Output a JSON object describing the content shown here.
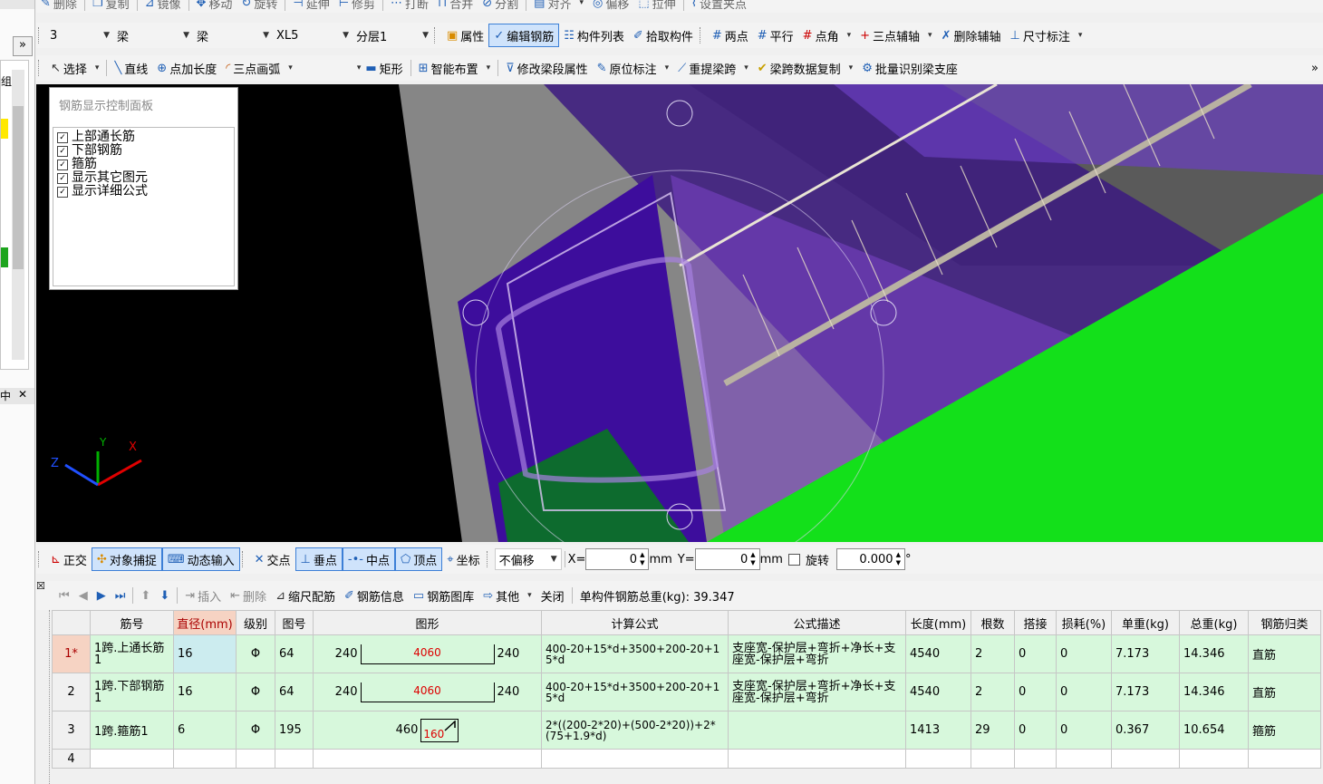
{
  "toolbar_top": {
    "items": [
      "删除",
      "复制",
      "镜像",
      "移动",
      "旋转",
      "延伸",
      "修剪",
      "打断",
      "合并",
      "分割",
      "对齐",
      "偏移",
      "拉伸",
      "设置夹点"
    ]
  },
  "left_pane": {
    "collapse": "»",
    "label": "组",
    "pin_label": "中",
    "close": "✕"
  },
  "toolbar2": {
    "combo_floor": "3",
    "combo_type1": "梁",
    "combo_type2": "梁",
    "combo_name": "XL5",
    "combo_layer": "分层1",
    "items": [
      "属性",
      "编辑钢筋",
      "构件列表",
      "拾取构件",
      "两点",
      "平行",
      "点角",
      "三点辅轴",
      "删除辅轴",
      "尺寸标注"
    ]
  },
  "toolbar3": {
    "items": [
      "选择",
      "直线",
      "点加长度",
      "三点画弧",
      "矩形",
      "智能布置",
      "修改梁段属性",
      "原位标注",
      "重提梁跨",
      "梁跨数据复制",
      "批量识别梁支座"
    ],
    "more": "»"
  },
  "rebar_panel": {
    "title": "钢筋显示控制面板",
    "options": [
      "上部通长筋",
      "下部钢筋",
      "箍筋",
      "显示其它图元",
      "显示详细公式"
    ]
  },
  "axes": {
    "x": "X",
    "y": "Y",
    "z": "Z"
  },
  "snap_bar": {
    "items": [
      "正交",
      "对象捕捉",
      "动态输入",
      "交点",
      "垂点",
      "中点",
      "顶点",
      "坐标"
    ],
    "offset_mode": "不偏移",
    "x_label": "X=",
    "x_value": "0",
    "y_label": "Y=",
    "y_value": "0",
    "unit": "mm",
    "rotate_label": "旋转",
    "rotate_value": "0.000",
    "degree": "°"
  },
  "tab_bar": {
    "items": [
      "插入",
      "删除",
      "缩尺配筋",
      "钢筋信息",
      "钢筋图库",
      "其他",
      "关闭"
    ],
    "total_weight": "单构件钢筋总重(kg): 39.347"
  },
  "table": {
    "headers": [
      "筋号",
      "直径(mm)",
      "级别",
      "图号",
      "图形",
      "计算公式",
      "公式描述",
      "长度(mm)",
      "根数",
      "搭接",
      "损耗(%)",
      "单重(kg)",
      "总重(kg)",
      "钢筋归类"
    ],
    "rows": [
      {
        "idx": "1*",
        "name": "1跨.上通长筋1",
        "diameter": "16",
        "grade": "Φ",
        "fig": "64",
        "left": "240",
        "mid": "4060",
        "right": "240",
        "formula": "400-20+15*d+3500+200-20+15*d",
        "desc": "支座宽-保护层+弯折+净长+支座宽-保护层+弯折",
        "length": "4540",
        "count": "2",
        "lap": "0",
        "loss": "0",
        "unit_w": "7.173",
        "total_w": "14.346",
        "category": "直筋"
      },
      {
        "idx": "2",
        "name": "1跨.下部钢筋1",
        "diameter": "16",
        "grade": "Φ",
        "fig": "64",
        "left": "240",
        "mid": "4060",
        "right": "240",
        "formula": "400-20+15*d+3500+200-20+15*d",
        "desc": "支座宽-保护层+弯折+净长+支座宽-保护层+弯折",
        "length": "4540",
        "count": "2",
        "lap": "0",
        "loss": "0",
        "unit_w": "7.173",
        "total_w": "14.346",
        "category": "直筋"
      },
      {
        "idx": "3",
        "name": "1跨.箍筋1",
        "diameter": "6",
        "grade": "Φ",
        "fig": "195",
        "left": "460",
        "mid": "160",
        "right": "",
        "formula": "2*((200-2*20)+(500-2*20))+2*(75+1.9*d)",
        "desc": "",
        "length": "1413",
        "count": "29",
        "lap": "0",
        "loss": "0",
        "unit_w": "0.367",
        "total_w": "10.654",
        "category": "箍筋"
      },
      {
        "idx": "4"
      }
    ]
  },
  "colors": {
    "purple": "#4b1a9e",
    "green": "#16e21a",
    "grid_row": "#d7f8dc",
    "selected": "#cfe3fb"
  }
}
